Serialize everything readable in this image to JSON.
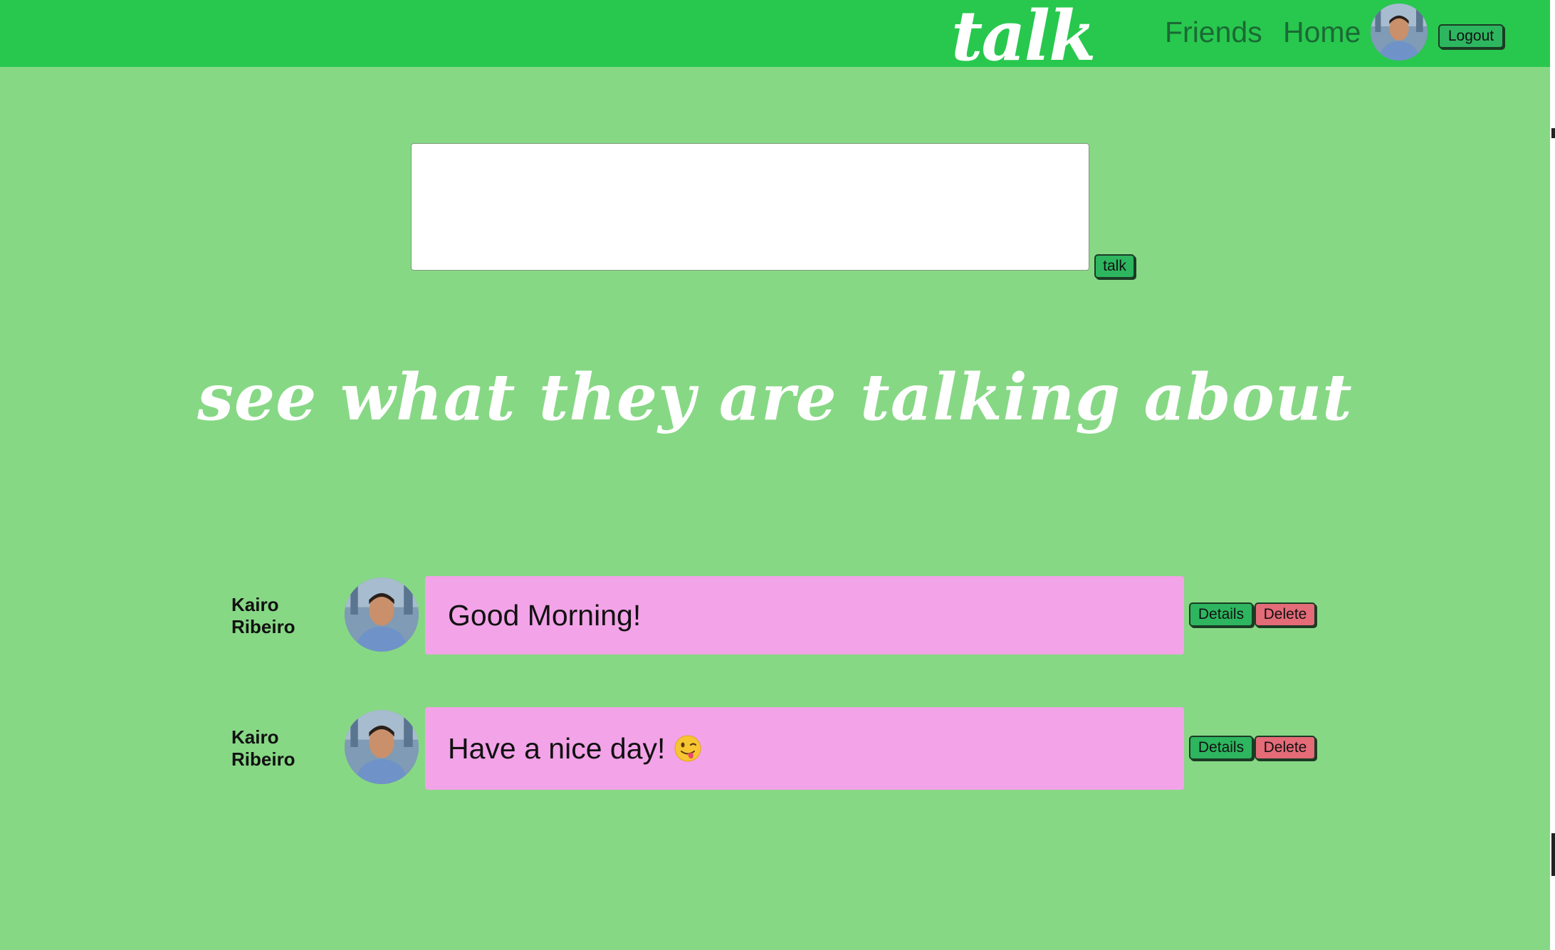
{
  "header": {
    "logo": "talk",
    "nav": {
      "friends": "Friends",
      "home": "Home"
    },
    "logout_label": "Logout",
    "avatar_icon": "user-avatar-icon"
  },
  "compose": {
    "value": "",
    "placeholder": "",
    "submit_label": "talk"
  },
  "feed": {
    "heading": "see what they are talking about",
    "posts": [
      {
        "author": "Kairo Ribeiro",
        "text": "Good Morning!",
        "details_label": "Details",
        "delete_label": "Delete"
      },
      {
        "author": "Kairo Ribeiro",
        "text": "Have a nice day!",
        "emoji_icon": "winking-face-with-tongue-icon",
        "details_label": "Details",
        "delete_label": "Delete"
      }
    ]
  },
  "colors": {
    "page_background": "#87d885",
    "header_background": "#28c84e",
    "post_bubble": "#f3a3e8",
    "primary_button": "#2db65f",
    "danger_button": "#e46b78"
  }
}
